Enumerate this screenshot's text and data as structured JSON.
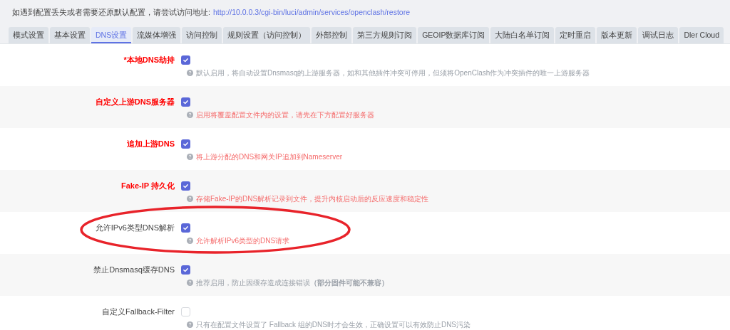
{
  "notice": {
    "text": "如遇到配置丢失或者需要还原默认配置，请尝试访问地址:",
    "link": "http://10.0.0.3/cgi-bin/luci/admin/services/openclash/restore"
  },
  "tabs": [
    {
      "label": "模式设置",
      "selected": false
    },
    {
      "label": "基本设置",
      "selected": false
    },
    {
      "label": "DNS设置",
      "selected": true
    },
    {
      "label": "流媒体增强",
      "selected": false
    },
    {
      "label": "访问控制",
      "selected": false
    },
    {
      "label": "规则设置（访问控制）",
      "selected": false
    },
    {
      "label": "外部控制",
      "selected": false
    },
    {
      "label": "第三方规则订阅",
      "selected": false
    },
    {
      "label": "GEOIP数据库订阅",
      "selected": false
    },
    {
      "label": "大陆白名单订阅",
      "selected": false
    },
    {
      "label": "定时重启",
      "selected": false
    },
    {
      "label": "版本更新",
      "selected": false
    },
    {
      "label": "调试日志",
      "selected": false
    },
    {
      "label": "Dler Cloud",
      "selected": false
    }
  ],
  "options": [
    {
      "label": "*本地DNS劫持",
      "emphasized": true,
      "checked": true,
      "hint": "默认启用，将自动设置Dnsmasq的上游服务器，如和其他插件冲突可停用，但须将OpenClash作为冲突插件的唯一上游服务器",
      "hint_warning": false,
      "circled": false
    },
    {
      "label": "自定义上游DNS服务器",
      "emphasized": true,
      "checked": true,
      "hint": "启用将覆盖配置文件内的设置，请先在下方配置好服务器",
      "hint_warning": true,
      "circled": false
    },
    {
      "label": "追加上游DNS",
      "emphasized": true,
      "checked": true,
      "hint": "将上游分配的DNS和网关IP追加到Nameserver",
      "hint_warning": true,
      "circled": false
    },
    {
      "label": "Fake-IP 持久化",
      "emphasized": true,
      "checked": true,
      "hint": "存储Fake-IP的DNS解析记录到文件，提升内核启动后的反应速度和稳定性",
      "hint_warning": true,
      "circled": false
    },
    {
      "label": "允许IPv6类型DNS解析",
      "emphasized": false,
      "checked": true,
      "hint": "允许解析IPv6类型的DNS请求",
      "hint_warning": true,
      "circled": true
    },
    {
      "label": "禁止Dnsmasq缓存DNS",
      "emphasized": false,
      "checked": true,
      "hint": "推荐启用，防止因缓存造成连接错误**（部分固件可能不兼容）**",
      "hint_warning": false,
      "circled": false
    },
    {
      "label": "自定义Fallback-Filter",
      "emphasized": false,
      "checked": false,
      "hint": "只有在配置文件设置了 Fallback 组的DNS时才会生效，正确设置可以有效防止DNS污染",
      "hint_warning": false,
      "circled": false
    }
  ]
}
